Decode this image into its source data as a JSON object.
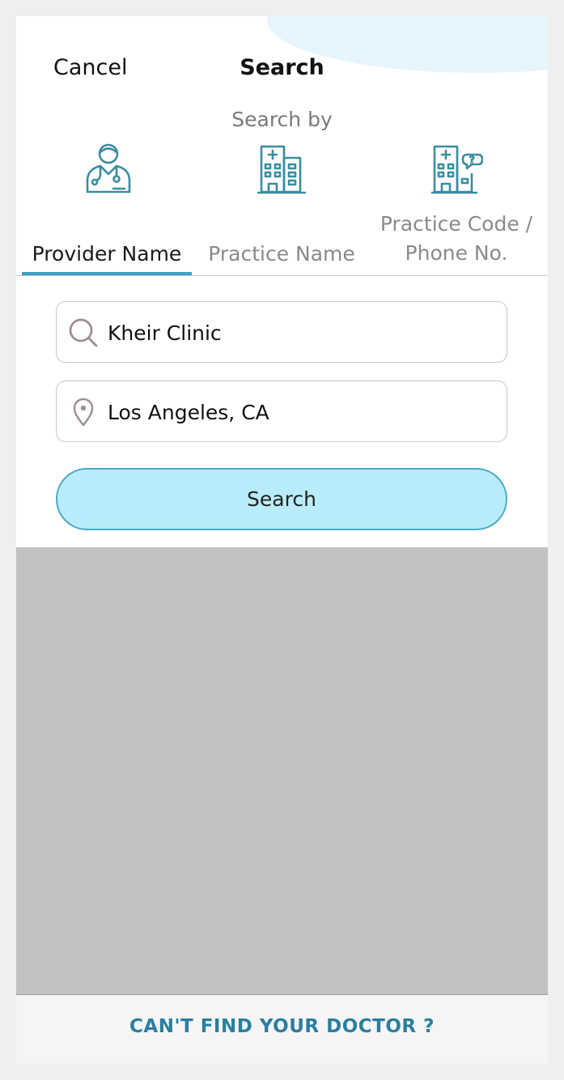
{
  "header": {
    "cancel_label": "Cancel",
    "title": "Search"
  },
  "search_by": {
    "heading": "Search by",
    "tabs": [
      {
        "label": "Provider Name",
        "icon": "doctor-icon",
        "active": true
      },
      {
        "label": "Practice Name",
        "icon": "hospital-building-icon",
        "active": false
      },
      {
        "label_line1": "Practice Code /",
        "label_line2": "Phone No.",
        "icon": "hospital-question-icon",
        "active": false
      }
    ]
  },
  "form": {
    "query_value": "Kheir Clinic",
    "query_icon": "search-icon",
    "location_value": "Los Angeles, CA",
    "location_icon": "location-pin-icon",
    "submit_label": "Search"
  },
  "footer": {
    "link_label": "CAN'T FIND YOUR DOCTOR ?"
  },
  "colors": {
    "accent": "#3c9fc4",
    "button_fill": "#b9ecfa",
    "icon_teal": "#3a8d9f",
    "footer_link": "#2a7ea0",
    "results_bg": "#c2c2c2"
  }
}
